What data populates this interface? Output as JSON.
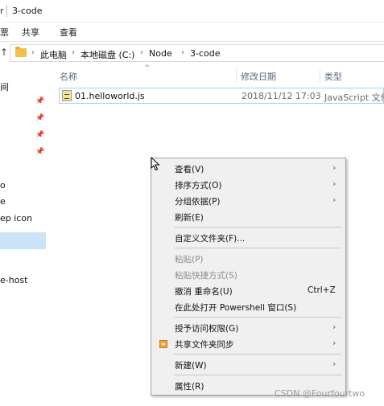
{
  "window": {
    "title_fragment": "r",
    "title": "3-code"
  },
  "ribbon": {
    "tabs": [
      "票",
      "共享",
      "查看"
    ]
  },
  "address": {
    "crumbs": [
      "此电脑",
      "本地磁盘 (C:)",
      "Node",
      "3-code"
    ]
  },
  "nav": {
    "items": [
      "间",
      "o",
      "e",
      "ep icon",
      "e-host"
    ]
  },
  "columns": {
    "name": "名称",
    "date": "修改日期",
    "type": "类型"
  },
  "files": [
    {
      "name": "01.helloworld.js",
      "date": "2018/11/12 17:03",
      "type": "JavaScript 文件"
    }
  ],
  "context_menu": {
    "items": [
      {
        "label": "查看(V)",
        "submenu": true,
        "enabled": true
      },
      {
        "label": "排序方式(O)",
        "submenu": true,
        "enabled": true
      },
      {
        "label": "分组依据(P)",
        "submenu": true,
        "enabled": true
      },
      {
        "label": "刷新(E)",
        "submenu": false,
        "enabled": true
      },
      {
        "label": "自定义文件夹(F)...",
        "submenu": false,
        "enabled": true
      },
      {
        "label": "粘贴(P)",
        "submenu": false,
        "enabled": false
      },
      {
        "label": "粘贴快捷方式(S)",
        "submenu": false,
        "enabled": false
      },
      {
        "label": "撤消 重命名(U)",
        "submenu": false,
        "enabled": true,
        "shortcut": "Ctrl+Z"
      },
      {
        "label": "在此处打开 Powershell 窗口(S)",
        "submenu": false,
        "enabled": true
      },
      {
        "label": "授予访问权限(G)",
        "submenu": true,
        "enabled": true
      },
      {
        "label": "共享文件夹同步",
        "submenu": true,
        "enabled": true,
        "icon": "sync-folder-icon"
      },
      {
        "label": "新建(W)",
        "submenu": true,
        "enabled": true
      },
      {
        "label": "属性(R)",
        "submenu": false,
        "enabled": true
      }
    ],
    "arrow_glyph": "›"
  },
  "watermark": "CSDN @Fourfourtwo",
  "icons": {
    "up": "up-arrow-icon",
    "folder": "folder-icon",
    "chevron": "chevron-right-icon",
    "pin": "pin-icon",
    "js_file": "js-file-icon",
    "cursor": "mouse-cursor-icon"
  },
  "colors": {
    "selection": "#cce4f7",
    "menu_bg": "#f0f0f0",
    "disabled_text": "#8d8d8d"
  }
}
